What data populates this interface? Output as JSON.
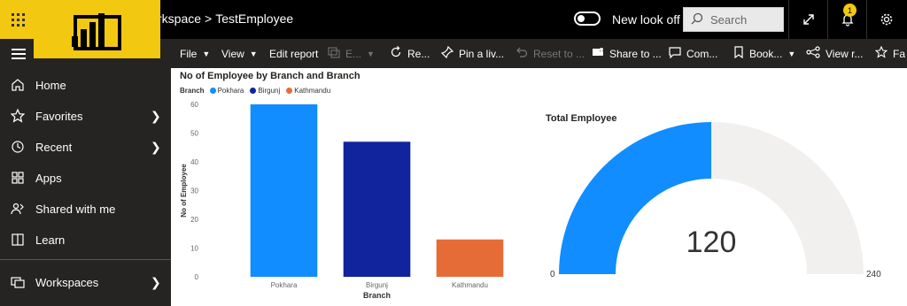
{
  "header": {
    "breadcrumb_workspace": "rkspace",
    "breadcrumb_sep": ">",
    "breadcrumb_report": "TestEmployee",
    "new_look_label": "New look off",
    "search_placeholder": "Search",
    "notification_count": "1"
  },
  "toolbar": {
    "file": "File",
    "view": "View",
    "edit_report": "Edit report",
    "explore": "E...",
    "refresh": "Re...",
    "pin": "Pin a liv...",
    "reset": "Reset to ...",
    "share": "Share to ...",
    "comment": "Com...",
    "bookmark": "Book...",
    "view_related": "View r...",
    "favorite": "Fa"
  },
  "nav": {
    "items": [
      {
        "label": "Home",
        "icon": "home-icon"
      },
      {
        "label": "Favorites",
        "icon": "star-icon"
      },
      {
        "label": "Recent",
        "icon": "clock-icon"
      },
      {
        "label": "Apps",
        "icon": "apps-icon"
      },
      {
        "label": "Shared with me",
        "icon": "shared-icon"
      },
      {
        "label": "Learn",
        "icon": "book-icon"
      },
      {
        "label": "Workspaces",
        "icon": "workspaces-icon"
      }
    ]
  },
  "colors": {
    "accent": "#f2c811",
    "pokhara": "#118dff",
    "birgunj": "#12239e",
    "kathmandu": "#e66c37",
    "gauge_bg": "#f1f0ef"
  },
  "chart_data": [
    {
      "type": "bar",
      "title": "No of Employee by Branch and Branch",
      "legend_title": "Branch",
      "categories": [
        "Pokhara",
        "Birgunj",
        "Kathmandu"
      ],
      "values": [
        60,
        47,
        13
      ],
      "xlabel": "Branch",
      "ylabel": "No of Employee",
      "ylim": [
        0,
        60
      ],
      "yticks": [
        0,
        10,
        20,
        30,
        40,
        50,
        60
      ],
      "legend_position": "top-left"
    },
    {
      "type": "gauge",
      "title": "Total Employee",
      "value": 120,
      "min": 0,
      "max": 240
    }
  ]
}
